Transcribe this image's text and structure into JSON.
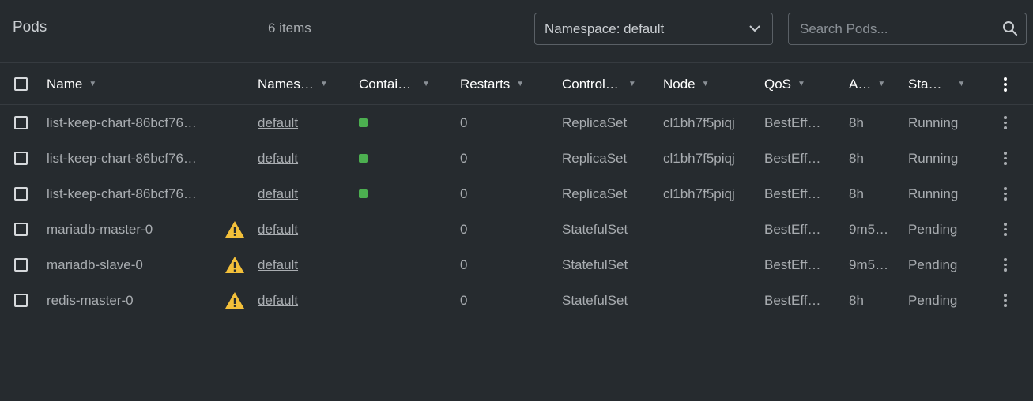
{
  "header": {
    "title": "Pods",
    "count": "6 items",
    "namespace_select": "Namespace: default",
    "search_placeholder": "Search Pods..."
  },
  "columns": [
    {
      "key": "name",
      "label": "Name"
    },
    {
      "key": "namespace",
      "label": "Names…"
    },
    {
      "key": "containers",
      "label": "Contai…"
    },
    {
      "key": "restarts",
      "label": "Restarts"
    },
    {
      "key": "controlled_by",
      "label": "Control…"
    },
    {
      "key": "node",
      "label": "Node"
    },
    {
      "key": "qos",
      "label": "QoS"
    },
    {
      "key": "age",
      "label": "A…"
    },
    {
      "key": "status",
      "label": "Sta…"
    }
  ],
  "rows": [
    {
      "name": "list-keep-chart-86bcf76…",
      "warning": false,
      "namespace": "default",
      "container_running": true,
      "restarts": "0",
      "controlled_by": "ReplicaSet",
      "node": "cl1bh7f5piqj",
      "qos": "BestEff…",
      "age": "8h",
      "status": "Running"
    },
    {
      "name": "list-keep-chart-86bcf76…",
      "warning": false,
      "namespace": "default",
      "container_running": true,
      "restarts": "0",
      "controlled_by": "ReplicaSet",
      "node": "cl1bh7f5piqj",
      "qos": "BestEff…",
      "age": "8h",
      "status": "Running"
    },
    {
      "name": "list-keep-chart-86bcf76…",
      "warning": false,
      "namespace": "default",
      "container_running": true,
      "restarts": "0",
      "controlled_by": "ReplicaSet",
      "node": "cl1bh7f5piqj",
      "qos": "BestEff…",
      "age": "8h",
      "status": "Running"
    },
    {
      "name": "mariadb-master-0",
      "warning": true,
      "namespace": "default",
      "container_running": false,
      "restarts": "0",
      "controlled_by": "StatefulSet",
      "node": "",
      "qos": "BestEff…",
      "age": "9m5…",
      "status": "Pending"
    },
    {
      "name": "mariadb-slave-0",
      "warning": true,
      "namespace": "default",
      "container_running": false,
      "restarts": "0",
      "controlled_by": "StatefulSet",
      "node": "",
      "qos": "BestEff…",
      "age": "9m5…",
      "status": "Pending"
    },
    {
      "name": "redis-master-0",
      "warning": true,
      "namespace": "default",
      "container_running": false,
      "restarts": "0",
      "controlled_by": "StatefulSet",
      "node": "",
      "qos": "BestEff…",
      "age": "8h",
      "status": "Pending"
    }
  ],
  "colors": {
    "background": "#262b2f",
    "link": "#3d90ce",
    "running": "#4caf50",
    "pending": "#ff9800",
    "warning": "#f3c03a"
  },
  "icons": {
    "sort": "triangle-down-icon",
    "search": "search-icon",
    "dropdown": "chevron-down-icon",
    "warning": "warning-icon",
    "menu": "kebab-menu-icon"
  }
}
